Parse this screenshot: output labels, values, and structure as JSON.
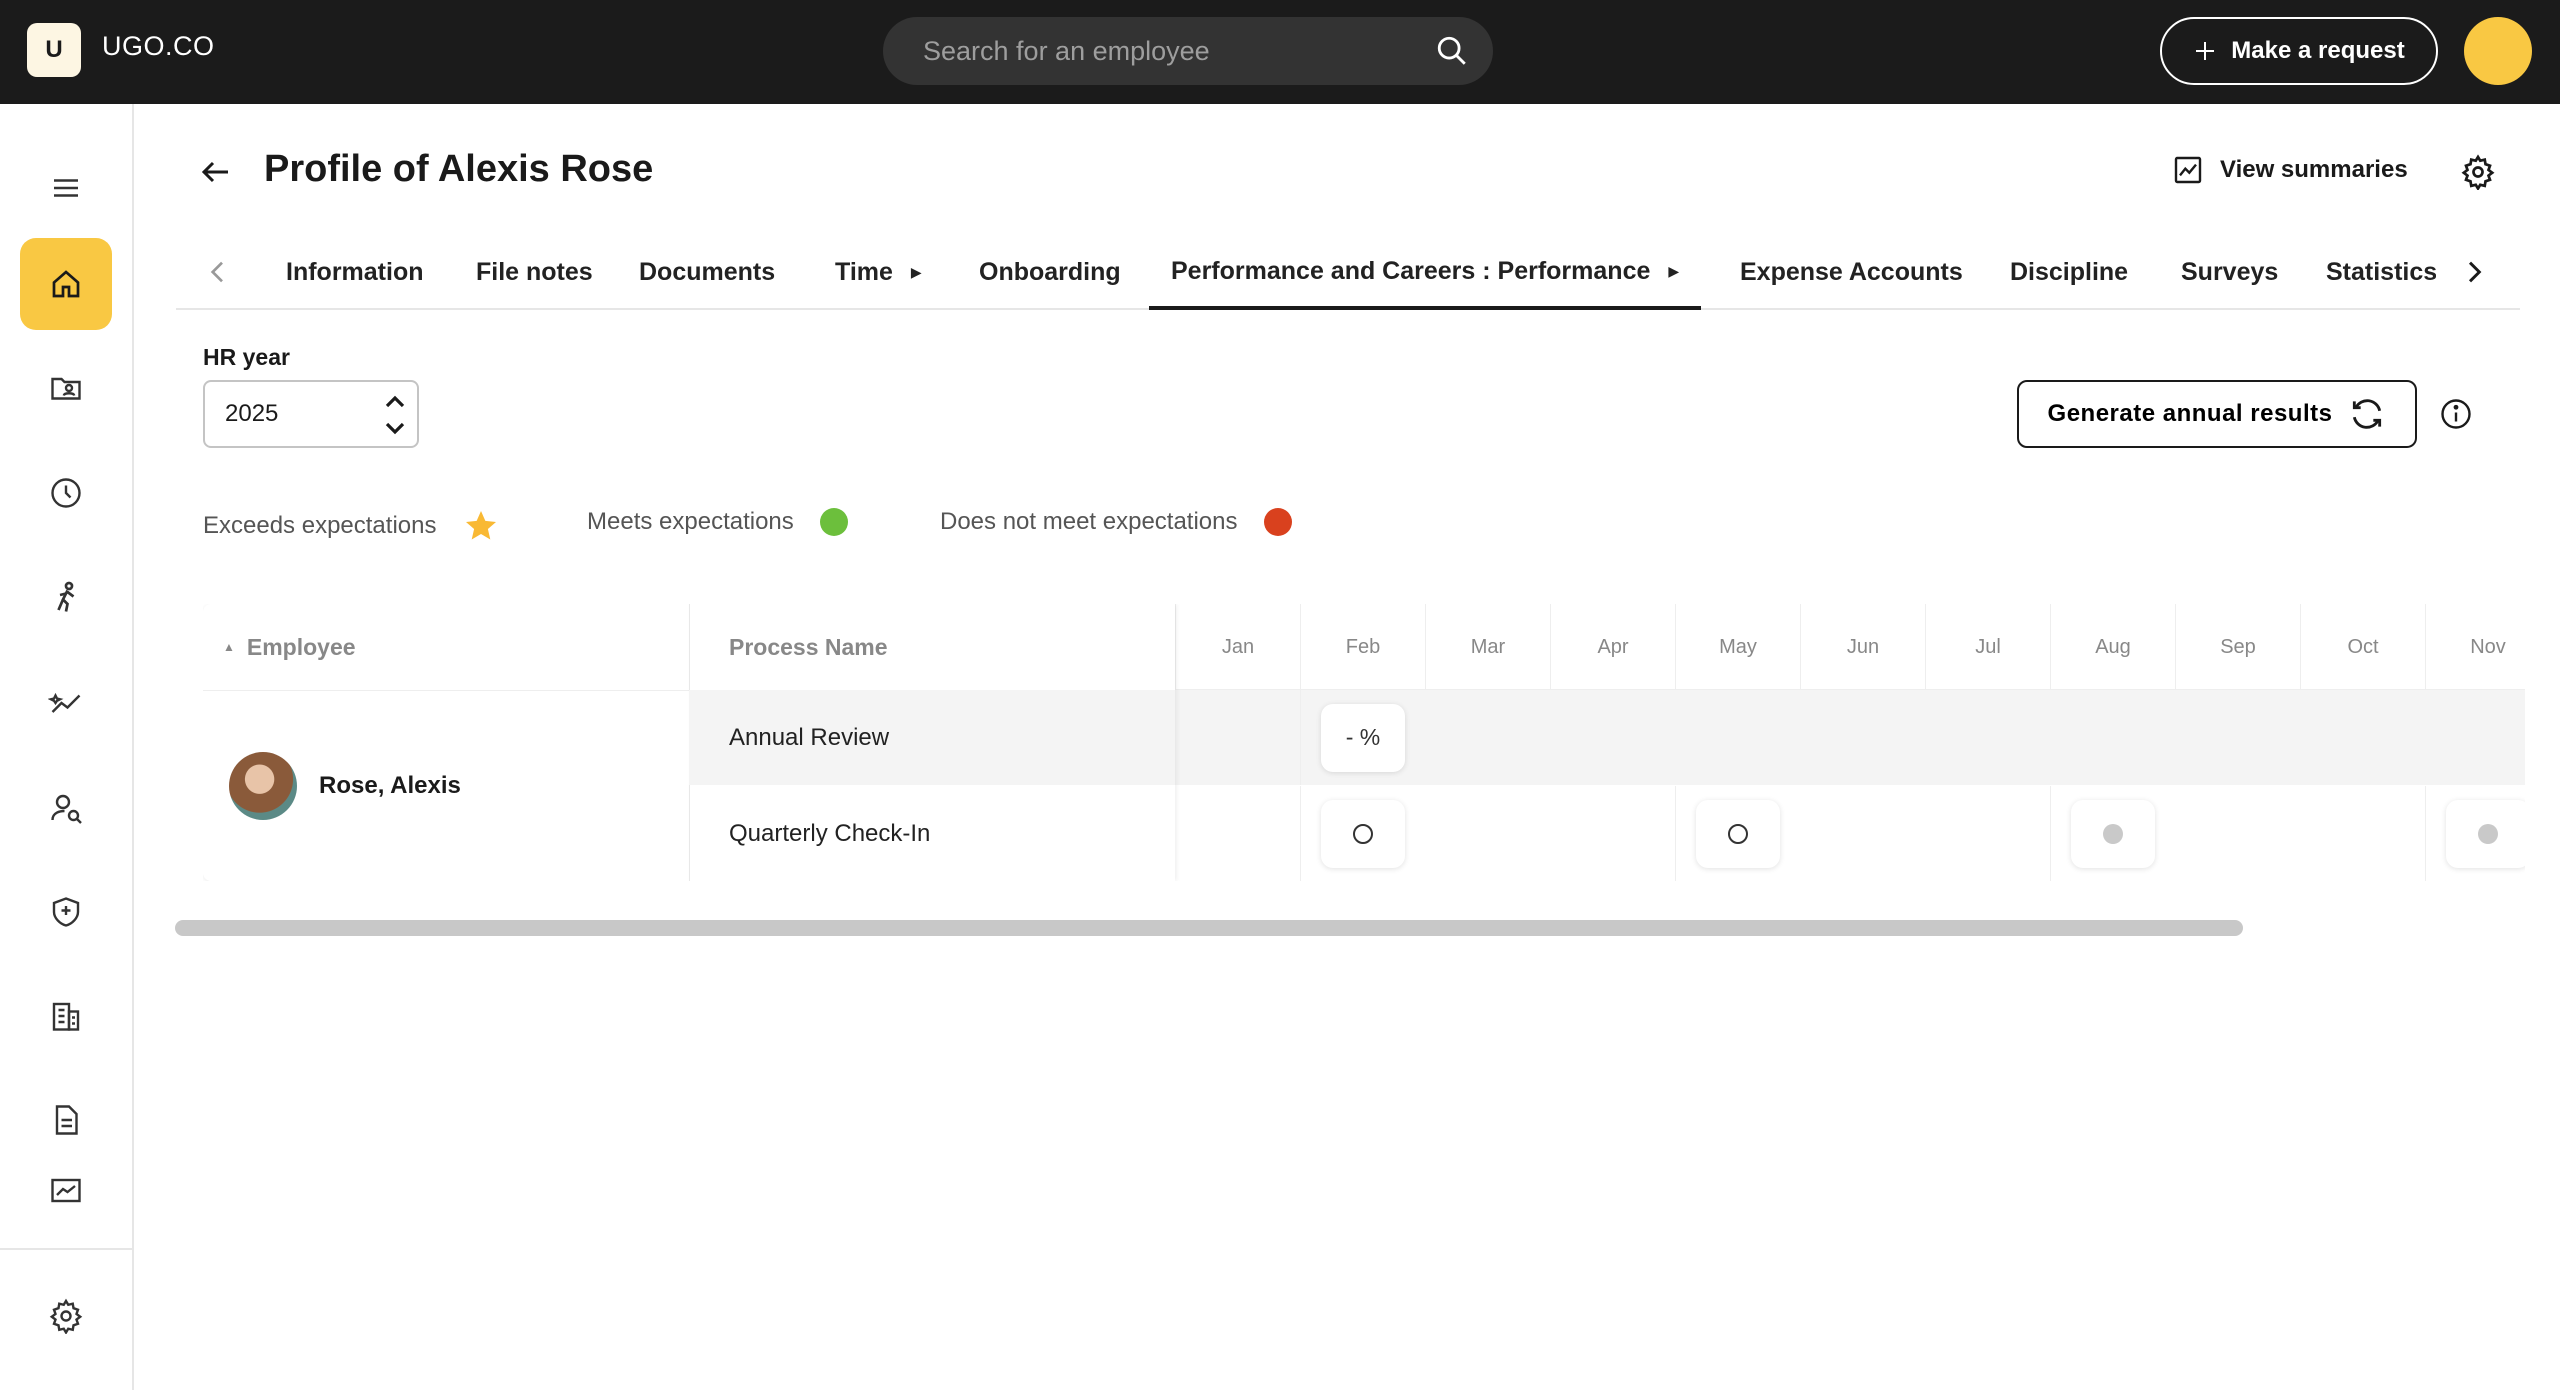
{
  "app": {
    "logo_letter": "U",
    "brand": "UGO.CO"
  },
  "search": {
    "placeholder": "Search for an employee"
  },
  "topbar": {
    "make_request_label": "Make a request"
  },
  "header": {
    "title": "Profile of Alexis Rose",
    "view_summaries_label": "View summaries"
  },
  "tabs": [
    {
      "label": "Information"
    },
    {
      "label": "File notes"
    },
    {
      "label": "Documents"
    },
    {
      "label": "Time"
    },
    {
      "label": "Onboarding"
    },
    {
      "label": "Performance and Careers : Performance",
      "active": true
    },
    {
      "label": "Expense Accounts"
    },
    {
      "label": "Discipline"
    },
    {
      "label": "Surveys"
    },
    {
      "label": "Statistics"
    }
  ],
  "hr_year": {
    "label": "HR year",
    "value": "2025"
  },
  "actions": {
    "generate_label": "Generate annual results"
  },
  "legend": [
    {
      "label": "Exceeds expectations",
      "icon": "star-icon",
      "color": "#f9b934"
    },
    {
      "label": "Meets expectations",
      "color": "#6cbf3c"
    },
    {
      "label": "Does not meet expectations",
      "color": "#d9411e"
    }
  ],
  "table": {
    "headers": {
      "employee": "Employee",
      "process": "Process Name"
    },
    "months": [
      "Jan",
      "Feb",
      "Mar",
      "Apr",
      "May",
      "Jun",
      "Jul",
      "Aug",
      "Sep",
      "Oct",
      "Nov"
    ],
    "employee": "Rose, Alexis",
    "rows": [
      {
        "process": "Annual Review",
        "cells": {
          "Feb": "- %"
        }
      },
      {
        "process": "Quarterly Check-In",
        "cells": {
          "Feb": "open-circle",
          "May": "open-circle",
          "Aug": "grey-dot",
          "Nov": "grey-dot"
        }
      }
    ]
  },
  "colors": {
    "accent": "#f9c843",
    "topbar": "#1b1b1b"
  }
}
